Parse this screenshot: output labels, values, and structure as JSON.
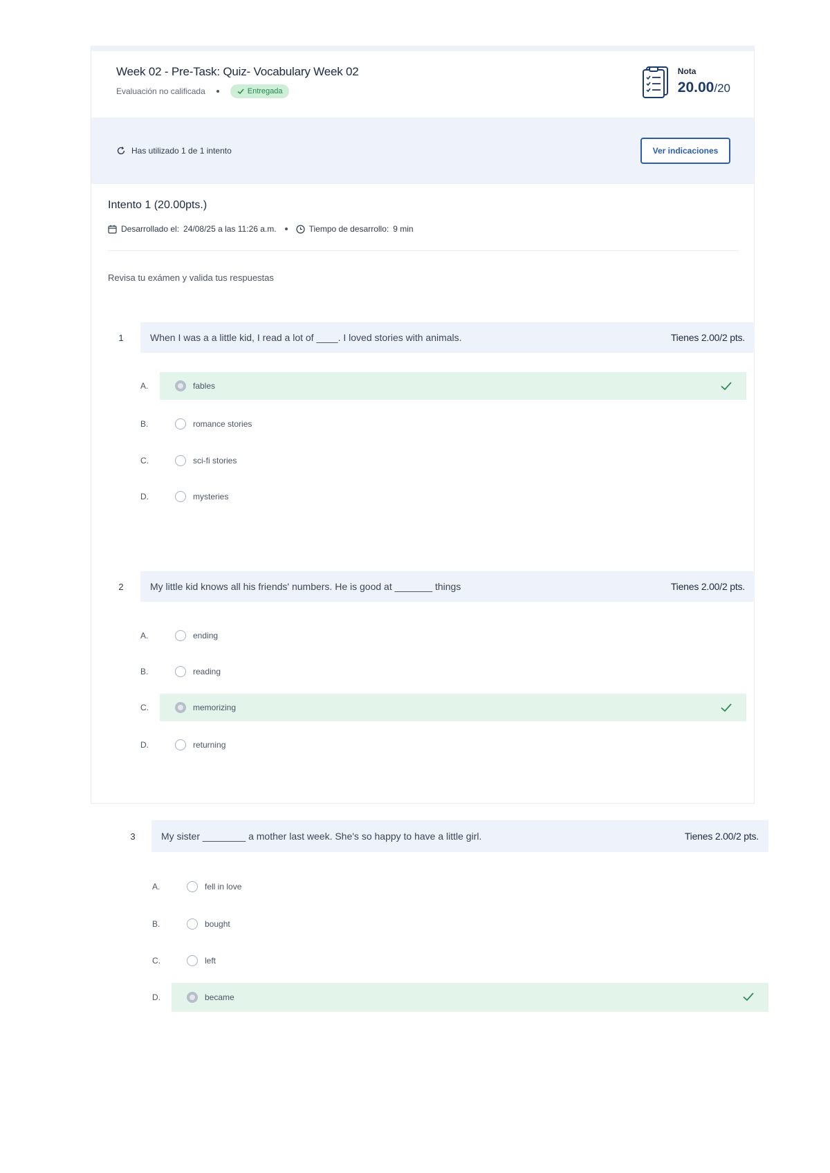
{
  "header": {
    "title": "Week 02 - Pre-Task: Quiz- Vocabulary Week 02",
    "evaluation_type": "Evaluación no calificada",
    "status_badge": "Entregada",
    "grade_label": "Nota",
    "grade_value": "20.00",
    "grade_max": "/20"
  },
  "attempt_bar": {
    "attempts_text": "Has utilizado 1 de 1 intento",
    "view_instructions_label": "Ver indicaciones"
  },
  "attempt": {
    "title": "Intento 1 (20.00pts.)",
    "developed_label": "Desarrollado el:",
    "developed_value": "24/08/25 a las 11:26 a.m.",
    "time_label": "Tiempo de desarrollo:",
    "time_value": "9 min",
    "review_text": "Revisa tu exámen y valida tus respuestas"
  },
  "questions": [
    {
      "number": "1",
      "text": "When I was a a little kid, I read a lot of ____. I loved stories with animals.",
      "score": "Tienes 2.00/2 pts.",
      "options": [
        {
          "letter": "A.",
          "text": "fables",
          "selected": true,
          "correct": true
        },
        {
          "letter": "B.",
          "text": "romance stories",
          "selected": false,
          "correct": false
        },
        {
          "letter": "C.",
          "text": "sci-fi stories",
          "selected": false,
          "correct": false
        },
        {
          "letter": "D.",
          "text": "mysteries",
          "selected": false,
          "correct": false
        }
      ]
    },
    {
      "number": "2",
      "text": "My little kid knows all his friends' numbers. He is good at _______ things",
      "score": "Tienes 2.00/2 pts.",
      "options": [
        {
          "letter": "A.",
          "text": "ending",
          "selected": false,
          "correct": false
        },
        {
          "letter": "B.",
          "text": "reading",
          "selected": false,
          "correct": false
        },
        {
          "letter": "C.",
          "text": "memorizing",
          "selected": true,
          "correct": true
        },
        {
          "letter": "D.",
          "text": "returning",
          "selected": false,
          "correct": false
        }
      ]
    },
    {
      "number": "3",
      "text": "My sister ________ a mother last week. She's so happy to have a little girl.",
      "score": "Tienes 2.00/2 pts.",
      "options": [
        {
          "letter": "A.",
          "text": "fell in love",
          "selected": false,
          "correct": false
        },
        {
          "letter": "B.",
          "text": "bought",
          "selected": false,
          "correct": false
        },
        {
          "letter": "C.",
          "text": "left",
          "selected": false,
          "correct": false
        },
        {
          "letter": "D.",
          "text": "became",
          "selected": true,
          "correct": true
        }
      ]
    }
  ],
  "colors": {
    "primary": "#2b5dab",
    "correct_bg": "#e3f4ea",
    "check": "#2e8b57",
    "badge_bg": "#cdefd8",
    "question_bar": "#eef3fb"
  }
}
